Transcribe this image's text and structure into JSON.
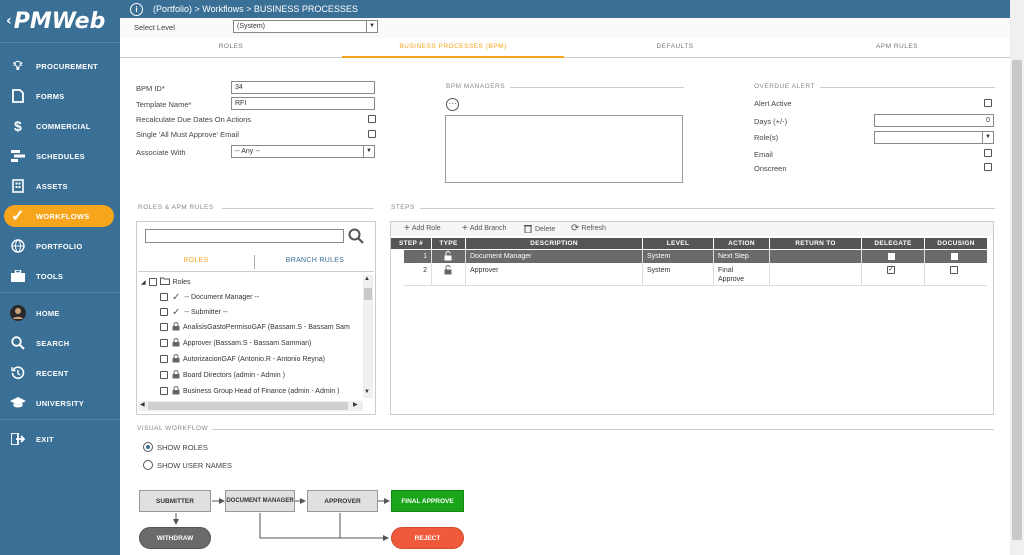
{
  "app": {
    "logo": "PMWeb",
    "breadcrumb": "(Portfolio) > Workflows > BUSINESS PROCESSES"
  },
  "sidebar": {
    "items": [
      {
        "label": "PROCUREMENT",
        "icon": "lightbulb-icon"
      },
      {
        "label": "FORMS",
        "icon": "document-icon"
      },
      {
        "label": "COMMERCIAL",
        "icon": "dollar-icon"
      },
      {
        "label": "SCHEDULES",
        "icon": "schedule-icon"
      },
      {
        "label": "ASSETS",
        "icon": "building-icon"
      },
      {
        "label": "WORKFLOWS",
        "icon": "check-icon"
      },
      {
        "label": "PORTFOLIO",
        "icon": "globe-icon"
      },
      {
        "label": "TOOLS",
        "icon": "toolbox-icon"
      },
      {
        "label": "HOME",
        "icon": "avatar-icon"
      },
      {
        "label": "SEARCH",
        "icon": "search-icon"
      },
      {
        "label": "RECENT",
        "icon": "history-icon"
      },
      {
        "label": "UNIVERSITY",
        "icon": "graduation-cap-icon"
      },
      {
        "label": "EXIT",
        "icon": "exit-icon"
      }
    ]
  },
  "level": {
    "label": "Select Level",
    "value": "(System)"
  },
  "tabs": [
    "ROLES",
    "BUSINESS PROCESSES (BPM)",
    "DEFAULTS",
    "APM RULES"
  ],
  "form": {
    "bpm_id_label": "BPM ID*",
    "bpm_id_value": "34",
    "template_label": "Template Name*",
    "template_value": "RFI",
    "recalc_label": "Recalculate Due Dates On Actions",
    "single_label": "Single 'All Must Approve' Email",
    "assoc_label": "Associate With",
    "assoc_value": "-- Any --"
  },
  "bpm_managers": {
    "title": "BPM MANAGERS"
  },
  "overdue": {
    "title": "OVERDUE ALERT",
    "alert_active": "Alert Active",
    "days_label": "Days (+/-)",
    "days_value": "0",
    "roles_label": "Role(s)",
    "email_label": "Email",
    "onscreen_label": "Onscreen"
  },
  "roles_apm": {
    "title": "ROLES & APM RULES",
    "tab_roles": "ROLES",
    "tab_branch": "BRANCH RULES",
    "tree": [
      "Roles",
      "-- Document Manager --",
      "-- Submitter --",
      "AnalisisGastoPermisoGAF (Bassam.S - Bassam Sam",
      "Approver (Bassam.S - Bassam Samman)",
      "AutorizacionGAF (Antonio.R - Antonio Reyna)",
      "Board Directors (admin - Admin )",
      "Business Group Head of Finance (admin - Admin )"
    ]
  },
  "steps": {
    "title": "STEPS",
    "toolbar": {
      "add_role": "Add Role",
      "add_branch": "Add Branch",
      "delete": "Delete",
      "refresh": "Refresh"
    },
    "headers": [
      "STEP #",
      "TYPE",
      "DESCRIPTION",
      "LEVEL",
      "ACTION",
      "RETURN TO",
      "DELEGATE",
      "DOCUSIGN"
    ],
    "rows": [
      {
        "step": "1",
        "description": "Document Manager",
        "level": "System",
        "action": "Next Step",
        "delegate": false,
        "docusign": false
      },
      {
        "step": "2",
        "description": "Approver",
        "level": "System",
        "action": "Final Approve",
        "delegate": true,
        "docusign": false
      }
    ]
  },
  "visual": {
    "title": "VISUAL WORKFLOW",
    "show_roles": "SHOW ROLES",
    "show_users": "SHOW USER NAMES",
    "nodes": {
      "submitter": "SUBMITTER",
      "doc_manager": "DOCUMENT MANAGER",
      "approver": "APPROVER",
      "final": "FINAL APPROVE",
      "withdraw": "WITHDRAW",
      "reject": "REJECT"
    }
  },
  "colors": {
    "sidebar": "#3a6f96",
    "accent": "#f7a51c",
    "final": "#1aa51a",
    "reject": "#f05a3c",
    "withdraw": "#6a6a6a"
  }
}
